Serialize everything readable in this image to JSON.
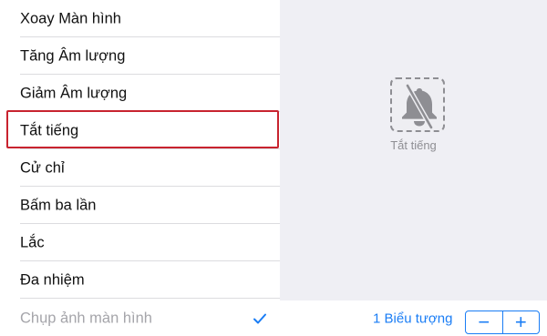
{
  "list": {
    "items": [
      {
        "label": "Xoay Màn hình",
        "selected": false,
        "disabled": false
      },
      {
        "label": "Tăng Âm lượng",
        "selected": false,
        "disabled": false
      },
      {
        "label": "Giảm Âm lượng",
        "selected": false,
        "disabled": false
      },
      {
        "label": "Tắt tiếng",
        "selected": false,
        "disabled": false,
        "highlighted": true
      },
      {
        "label": "Cử chỉ",
        "selected": false,
        "disabled": false
      },
      {
        "label": "Bấm ba lần",
        "selected": false,
        "disabled": false
      },
      {
        "label": "Lắc",
        "selected": false,
        "disabled": false
      },
      {
        "label": "Đa nhiệm",
        "selected": false,
        "disabled": false
      },
      {
        "label": "Chụp ảnh màn hình",
        "selected": true,
        "disabled": true
      }
    ]
  },
  "preview": {
    "icon": "bell-slash-icon",
    "caption": "Tắt tiếng"
  },
  "footer": {
    "count_label": "1 Biểu tượng",
    "minus_label": "−",
    "plus_label": "+"
  },
  "colors": {
    "accent": "#1a7df5",
    "highlight": "#c8232f",
    "panel_bg": "#efeff4"
  }
}
